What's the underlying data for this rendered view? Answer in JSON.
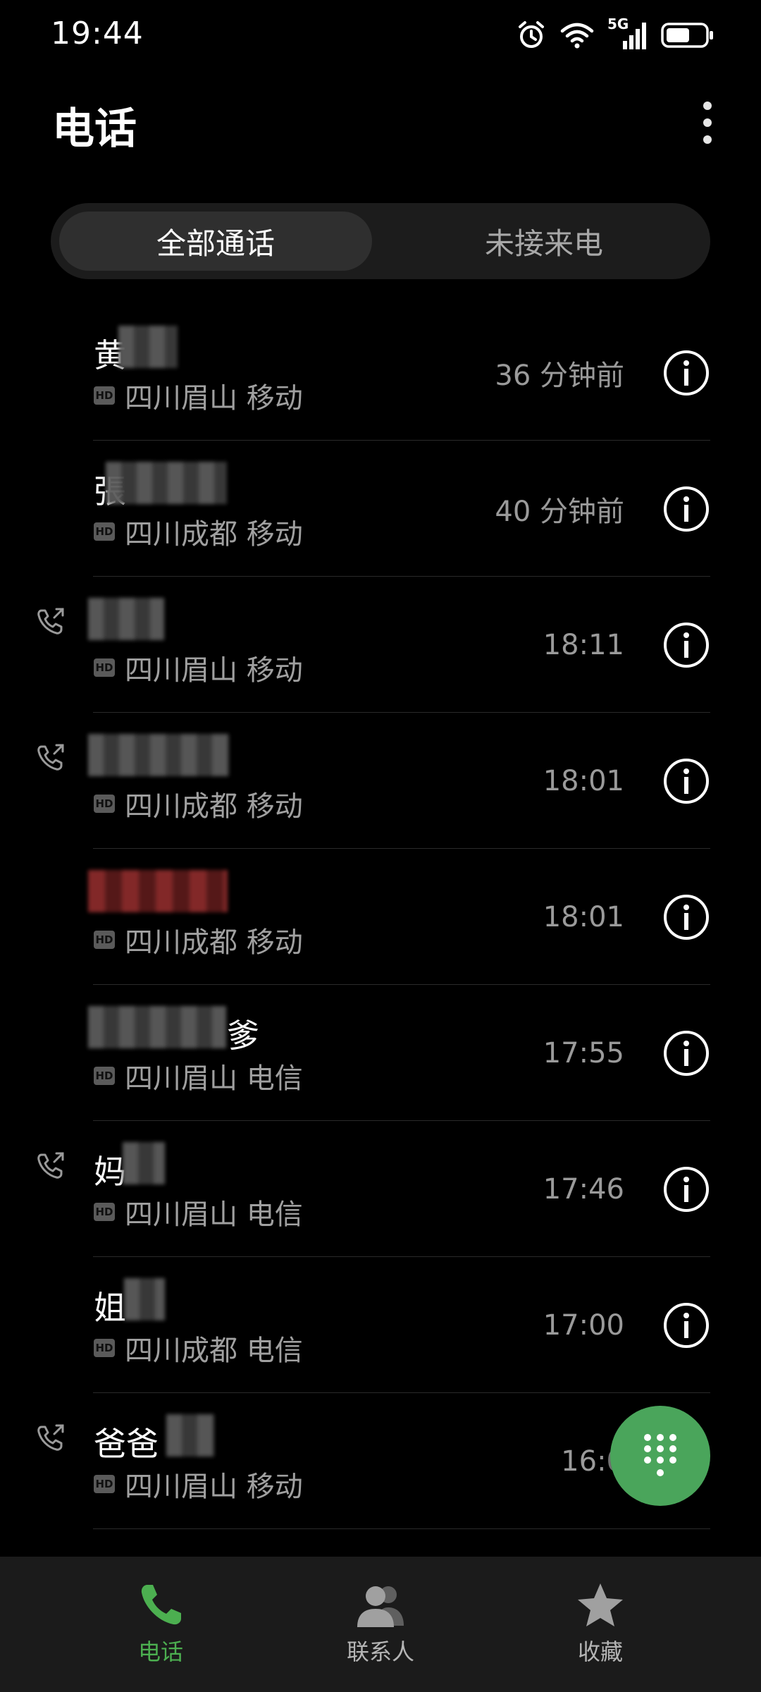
{
  "status_bar": {
    "time": "19:44",
    "network_label": "5G",
    "icons": [
      "alarm-icon",
      "wifi-icon",
      "signal-icon",
      "battery-icon"
    ]
  },
  "header": {
    "title": "电话",
    "more_icon": "more-vertical-icon"
  },
  "tabs": [
    {
      "label": "全部通话",
      "selected": true
    },
    {
      "label": "未接来电",
      "selected": false
    }
  ],
  "calls": [
    {
      "name": "黄",
      "location": "四川眉山 移动",
      "time": "36 分钟前",
      "outgoing": false,
      "hd": "HD",
      "masked": true
    },
    {
      "name": "張",
      "location": "四川成都 移动",
      "time": "40 分钟前",
      "outgoing": false,
      "hd": "HD",
      "masked": true
    },
    {
      "name": "",
      "location": "四川眉山 移动",
      "time": "18:11",
      "outgoing": true,
      "hd": "HD",
      "masked": true
    },
    {
      "name": "",
      "location": "四川成都 移动",
      "time": "18:01",
      "outgoing": true,
      "hd": "HD",
      "masked": true
    },
    {
      "name": "",
      "location": "四川成都 移动",
      "time": "18:01",
      "outgoing": false,
      "hd": "HD",
      "masked": true,
      "red": true
    },
    {
      "name": "爹",
      "location": "四川眉山 电信",
      "time": "17:55",
      "outgoing": false,
      "hd": "HD",
      "masked": true
    },
    {
      "name": "妈",
      "location": "四川眉山 电信",
      "time": "17:46",
      "outgoing": true,
      "hd": "HD",
      "masked": true
    },
    {
      "name": "姐",
      "location": "四川成都 电信",
      "time": "17:00",
      "outgoing": false,
      "hd": "HD",
      "masked": true
    },
    {
      "name": "爸爸",
      "location": "四川眉山 移动",
      "time": "16:0",
      "outgoing": true,
      "hd": "HD",
      "masked": true
    }
  ],
  "fab": {
    "icon": "dialpad-icon",
    "color": "#4aa55b"
  },
  "bottom_nav": [
    {
      "label": "电话",
      "icon": "phone-icon",
      "active": true
    },
    {
      "label": "联系人",
      "icon": "contacts-icon",
      "active": false
    },
    {
      "label": "收藏",
      "icon": "star-icon",
      "active": false
    }
  ],
  "colors": {
    "accent": "#4caf50",
    "background": "#000000",
    "nav_background": "#1b1b1b"
  }
}
